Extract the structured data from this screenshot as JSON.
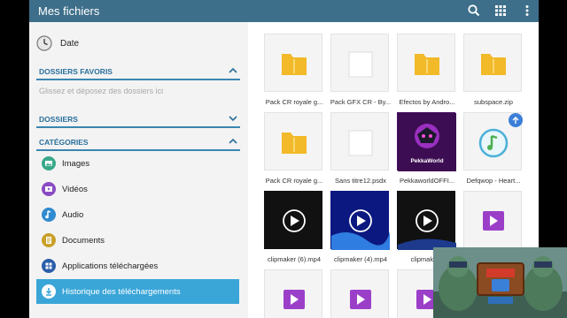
{
  "app": {
    "title": "Mes fichiers"
  },
  "sidebar": {
    "sort_label": "Date",
    "favorites_header": "DOSSIERS FAVORIS",
    "favorites_placeholder": "Glissez et déposez des dossiers ici",
    "folders_header": "DOSSIERS",
    "categories_header": "CATÉGORIES",
    "categories": [
      {
        "label": "Images",
        "icon": "image-icon"
      },
      {
        "label": "Vidéos",
        "icon": "video-icon"
      },
      {
        "label": "Audio",
        "icon": "audio-icon"
      },
      {
        "label": "Documents",
        "icon": "document-icon"
      },
      {
        "label": "Applications téléchargées",
        "icon": "apps-icon"
      },
      {
        "label": "Historique des téléchargements",
        "icon": "download-icon",
        "active": true
      }
    ]
  },
  "files": [
    {
      "name": "Pack CR royale g...",
      "type": "zip-folder"
    },
    {
      "name": "Pack GFX CR - By...",
      "type": "blank"
    },
    {
      "name": "Efectos by Andro...",
      "type": "zip-folder"
    },
    {
      "name": "subspace.zip",
      "type": "zip-folder"
    },
    {
      "name": "Pack CR royale g...",
      "type": "zip-folder"
    },
    {
      "name": "Sans titre12.psdx",
      "type": "blank"
    },
    {
      "name": "PekkaworldOFFI...",
      "type": "pekka-thumb",
      "thumb_text": "PekkaWorld"
    },
    {
      "name": "Defqwop - Heart...",
      "type": "audio"
    },
    {
      "name": "clipmaker (6).mp4",
      "type": "video-dark"
    },
    {
      "name": "clipmaker (4).mp4",
      "type": "video-blue"
    },
    {
      "name": "clipmaker (",
      "type": "video-dark"
    },
    {
      "name": "",
      "type": "video-purple"
    },
    {
      "name": "",
      "type": "video-purple"
    },
    {
      "name": "",
      "type": "video-purple"
    },
    {
      "name": "",
      "type": "zip-folder"
    }
  ],
  "colors": {
    "topbar": "#3e6f8a",
    "section_accent": "#2a6f9c",
    "active_item": "#3aa6d8",
    "folder": "#f2b928"
  }
}
